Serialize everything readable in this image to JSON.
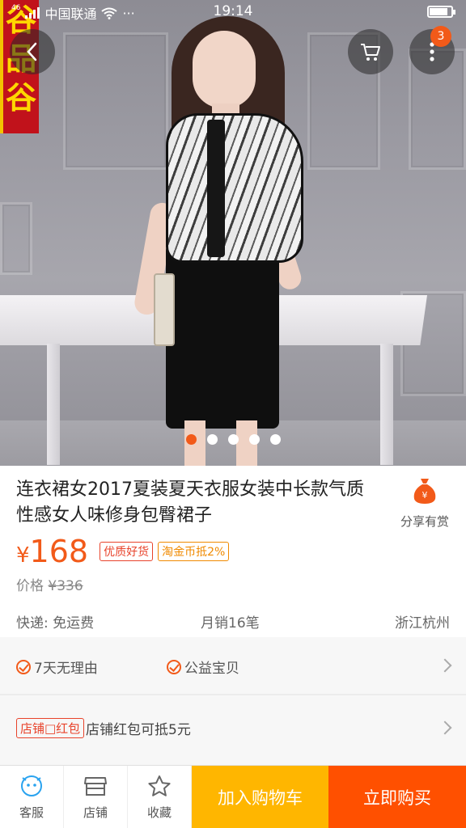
{
  "status_bar": {
    "signal": "46",
    "carrier": "中国联通",
    "dots": "···",
    "time": "19:14",
    "battery_level": 0.85
  },
  "store_badge": {
    "text": [
      "谷",
      "品",
      "谷"
    ]
  },
  "header": {
    "cart_badge": "3"
  },
  "gallery": {
    "image_count": 5,
    "active_index": 0
  },
  "product": {
    "title": "连衣裙女2017夏装夏天衣服女装中长款气质性感女人味修身包臀裙子",
    "share_label": "分享有赏",
    "currency": "¥",
    "price": "168",
    "tags": [
      "优质好货",
      "淘金币抵2%"
    ],
    "original_price_label": "价格",
    "original_price": "¥336",
    "shipping": "快递: 免运费",
    "monthly_sales": "月销16笔",
    "location": "浙江杭州"
  },
  "services": {
    "items": [
      "7天无理由",
      "公益宝贝"
    ]
  },
  "coupon": {
    "tag": "店铺□红包",
    "text": "店铺红包可抵5元"
  },
  "bottom_bar": {
    "service_label": "客服",
    "shop_label": "店铺",
    "favorite_label": "收藏",
    "add_to_cart": "加入购物车",
    "buy_now": "立即购买"
  },
  "colors": {
    "accent": "#f25a19",
    "add_cart_bg": "#ffb600",
    "buy_now_bg": "#ff5000"
  }
}
